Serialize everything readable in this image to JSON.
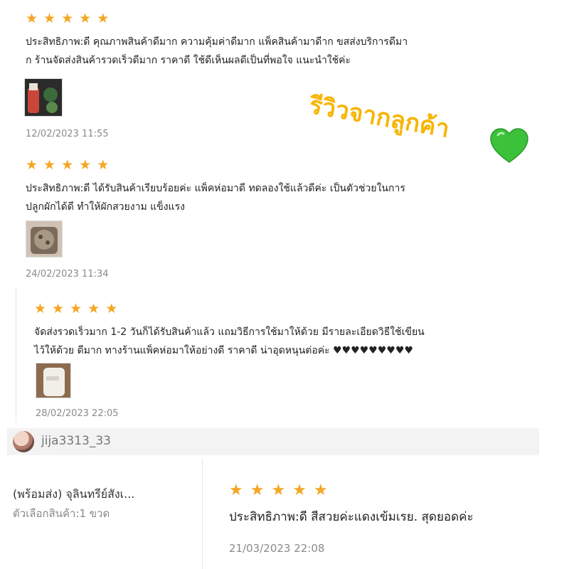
{
  "overlay": {
    "title": "รีวิวจากลูกค้า",
    "heart_color": "#3cc13b"
  },
  "reviews": [
    {
      "rating": 5,
      "text": "ประสิทธิภาพ:ดี คุณภาพสินค้าดีมาก ความคุ้มค่าดีมาก แพ็คสินค้ามาดีาก ขสส่งบริการดีมา\nก ร้านจัดส่งสินค้ารวดเร็วดีมาก ราคาดี ใช้ดีเห็นผลดีเป็นที่พอใจ แนะนำใช้ค่ะ",
      "date": "12/02/2023 11:55"
    },
    {
      "rating": 5,
      "text": "ประสิทธิภาพ:ดี ได้รับสินค้าเรียบร้อยค่ะ แพ็คห่อมาดี ทดลองใช้แล้วดีค่ะ เป็นตัวช่วยในการ\nปลูกผักได้ดี ทำให้ผักสวยงาม แข็งแรง",
      "date": "24/02/2023 11:34"
    },
    {
      "rating": 5,
      "text": "จัดส่งรวดเร็วมาก 1-2 วันก็ได้รับสินค้าแล้ว แถมวิธีการใช้มาให้ด้วย มีรายละเอียดวิธีใช้เขียน\nไว้ให้ด้วย ดีมาก ทางร้านแพ็คห่อมาให้อย่างดี ราคาดี น่าอุดหนุนต่อค่ะ ♥♥♥♥♥♥♥♥♥",
      "date": "28/02/2023 22:05"
    }
  ],
  "user": {
    "username": "jija3313_33"
  },
  "product": {
    "name": "(พร้อมส่ง) จุลินทรีย์สังเ...",
    "variation": "ตัวเลือกสินค้า:1 ขวด"
  },
  "review4": {
    "rating": 5,
    "text": "ประสิทธิภาพ:ดี สีสวยค่ะแดงเข้มเรย. สุดยอดค่ะ",
    "date": "21/03/2023 22:08"
  },
  "star_char": "★"
}
